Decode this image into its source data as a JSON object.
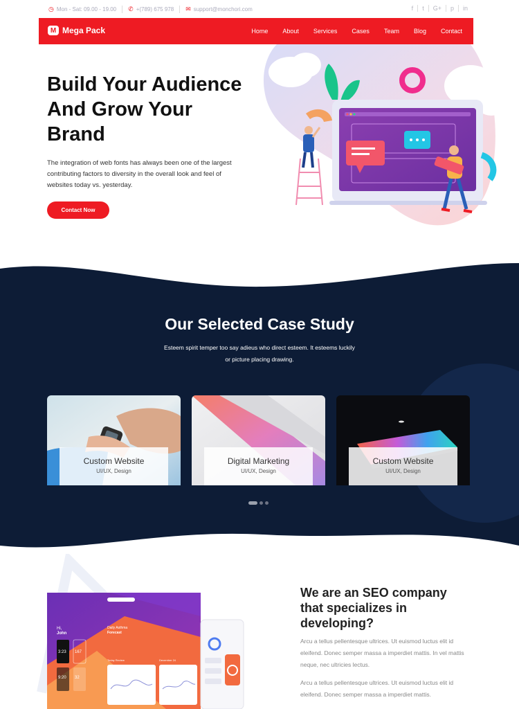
{
  "topbar": {
    "hours": "Mon - Sat: 09.00 - 19.00",
    "phone": "+(789) 675 978",
    "email": "support@monchori.com",
    "social": [
      "f",
      "t",
      "G+",
      "p",
      "in"
    ]
  },
  "nav": {
    "brand": "Mega Pack",
    "brand_mark": "M",
    "items": [
      "Home",
      "About",
      "Services",
      "Cases",
      "Team",
      "Blog",
      "Contact"
    ]
  },
  "hero": {
    "title_lines": [
      "Build Your Audience",
      "And Grow Your",
      "Brand"
    ],
    "text": "The integration of web fonts has always been one of the largest contributing factors to diversity in the overall look and feel of websites today vs. yesterday.",
    "button": "Contact Now"
  },
  "cases": {
    "title": "Our Selected Case Study",
    "subtitle": "Esteem spirit temper too say adieus who direct esteem. It esteems luckily or picture placing drawing.",
    "cards": [
      {
        "title": "Custom Website",
        "tags": "UI/UX, Design"
      },
      {
        "title": "Digital Marketing",
        "tags": "UI/UX, Design"
      },
      {
        "title": "Custom Website",
        "tags": "UI/UX, Design"
      }
    ]
  },
  "seo": {
    "title": "We are an SEO company that specializes in developing?",
    "p1": "Arcu a tellus pellentesque ultrices. Ut euismod luctus elit id eleifend. Donec semper massa a imperdiet mattis. In vel mattis neque, nec ultricies lectus.",
    "p2": "Arcu a tellus pellentesque ultrices. Ut euismod luctus elit id eleifend. Donec semper massa a imperdiet mattis."
  },
  "mockup": {
    "greeting": "Hi,",
    "user": "John",
    "card_title_1": "Daily Asthma",
    "card_title_2": "Forecast",
    "time": "3:23",
    "num1": "167",
    "num2": "9:20",
    "num3": "32",
    "review": "Today Review",
    "date": "December 24"
  },
  "colors": {
    "accent": "#ee1b23",
    "navy": "#0d1c36"
  }
}
